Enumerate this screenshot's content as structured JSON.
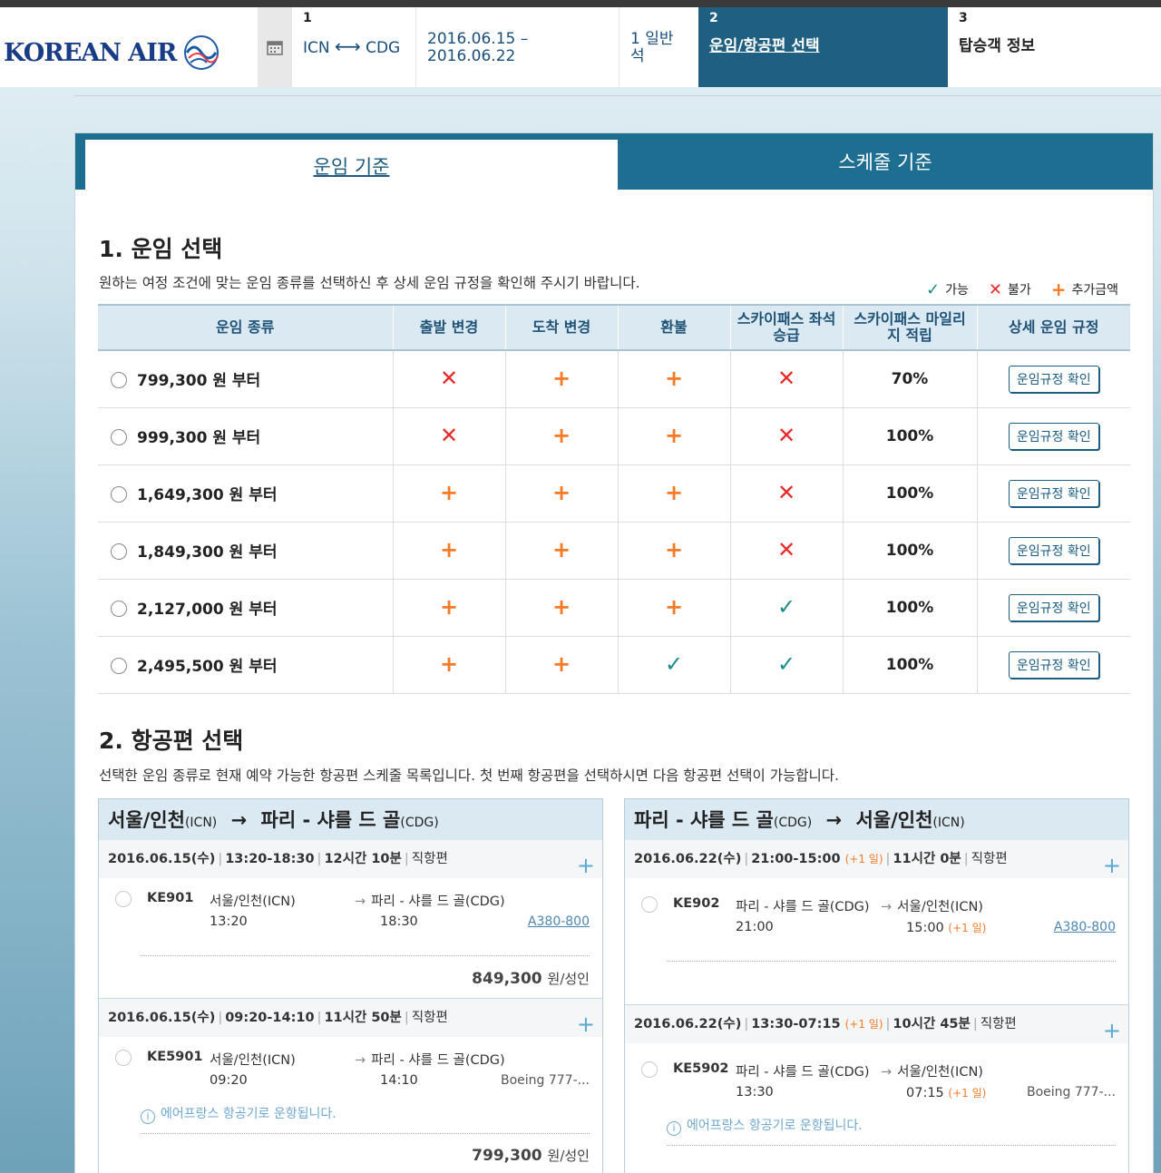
{
  "header": {
    "logo_text": "KOREAN AIR",
    "steps": {
      "route": {
        "num": "1",
        "origin": "ICN",
        "dest": "CDG"
      },
      "dates": {
        "line1": "2016.06.15 –",
        "line2": "2016.06.22"
      },
      "cabin": {
        "line1": "1 일반",
        "line2": "석"
      },
      "fare": {
        "num": "2",
        "label": "운임/항공편 선택"
      },
      "pax": {
        "num": "3",
        "label": "탑승객 정보"
      }
    }
  },
  "tabs": {
    "active": "운임 기준",
    "other": "스케줄 기준"
  },
  "section1": {
    "title": "1. 운임 선택",
    "desc": "원하는 여정 조건에 맞는 운임 종류를 선택하신 후 상세 운임 규정을 확인해 주시기 바랍니다.",
    "legend": {
      "available": "가능",
      "unavailable": "불가",
      "extra": "추가금액"
    },
    "columns": [
      "운임 종류",
      "출발 변경",
      "도착 변경",
      "환불",
      "스카이패스 좌석승급",
      "스카이패스 마일리지 적립",
      "상세 운임 규정"
    ],
    "rows": [
      {
        "price": "799,300 원 부터",
        "dep": "x",
        "arr": "plus",
        "refund": "plus",
        "upgrade": "x",
        "mileage": "70%",
        "btn": "운임규정 확인"
      },
      {
        "price": "999,300 원 부터",
        "dep": "x",
        "arr": "plus",
        "refund": "plus",
        "upgrade": "x",
        "mileage": "100%",
        "btn": "운임규정 확인"
      },
      {
        "price": "1,649,300 원 부터",
        "dep": "plus",
        "arr": "plus",
        "refund": "plus",
        "upgrade": "x",
        "mileage": "100%",
        "btn": "운임규정 확인"
      },
      {
        "price": "1,849,300 원 부터",
        "dep": "plus",
        "arr": "plus",
        "refund": "plus",
        "upgrade": "x",
        "mileage": "100%",
        "btn": "운임규정 확인"
      },
      {
        "price": "2,127,000 원 부터",
        "dep": "plus",
        "arr": "plus",
        "refund": "plus",
        "upgrade": "check",
        "mileage": "100%",
        "btn": "운임규정 확인"
      },
      {
        "price": "2,495,500 원 부터",
        "dep": "plus",
        "arr": "plus",
        "refund": "check",
        "upgrade": "check",
        "mileage": "100%",
        "btn": "운임규정 확인"
      }
    ]
  },
  "section2": {
    "title": "2. 항공편 선택",
    "desc": "선택한 운임 종류로 현재 예약 가능한 항공편 스케줄 목록입니다. 첫 번째 항공편을 선택하시면 다음 항공편 선택이 가능합니다."
  },
  "outbound": {
    "from": "서울/인천",
    "from_code": "(ICN)",
    "to": "파리 - 샤를 드 골",
    "to_code": "(CDG)",
    "flights": [
      {
        "date": "2016.06.15(수)",
        "time": "13:20-18:30",
        "duration": "12시간 10분",
        "type": "직항편",
        "code": "KE901",
        "dep_city": "서울/인천(ICN)",
        "dep_time": "13:20",
        "arr_city": "파리 - 샤를 드 골(CDG)",
        "arr_time": "18:30",
        "aircraft": "A380-800",
        "fare": "849,300",
        "fare_unit": "원/성인"
      },
      {
        "date": "2016.06.15(수)",
        "time": "09:20-14:10",
        "duration": "11시간 50분",
        "type": "직항편",
        "code": "KE5901",
        "dep_city": "서울/인천(ICN)",
        "dep_time": "09:20",
        "arr_city": "파리 - 샤를 드 골(CDG)",
        "arr_time": "14:10",
        "aircraft": "Boeing 777-...",
        "info": "에어프랑스 항공기로 운항됩니다.",
        "fare": "799,300",
        "fare_unit": "원/성인"
      }
    ]
  },
  "inbound": {
    "from": "파리 - 샤를 드 골",
    "from_code": "(CDG)",
    "to": "서울/인천",
    "to_code": "(ICN)",
    "flights": [
      {
        "date": "2016.06.22(수)",
        "time": "21:00-15:00",
        "plus_day": "(+1 일)",
        "duration": "11시간 0분",
        "type": "직항편",
        "code": "KE902",
        "dep_city": "파리 - 샤를 드 골(CDG)",
        "dep_time": "21:00",
        "arr_city": "서울/인천(ICN)",
        "arr_time": "15:00",
        "aircraft": "A380-800"
      },
      {
        "date": "2016.06.22(수)",
        "time": "13:30-07:15",
        "plus_day": "(+1 일)",
        "duration": "10시간 45분",
        "type": "직항편",
        "code": "KE5902",
        "dep_city": "파리 - 샤를 드 골(CDG)",
        "dep_time": "13:30",
        "arr_city": "서울/인천(ICN)",
        "arr_time": "07:15",
        "aircraft": "Boeing 777-...",
        "info": "에어프랑스 항공기로 운항됩니다."
      }
    ]
  },
  "colors": {
    "brand": "#1e5f82",
    "plus": "#f47a26",
    "x": "#e62929",
    "check": "#1a8b8d"
  }
}
